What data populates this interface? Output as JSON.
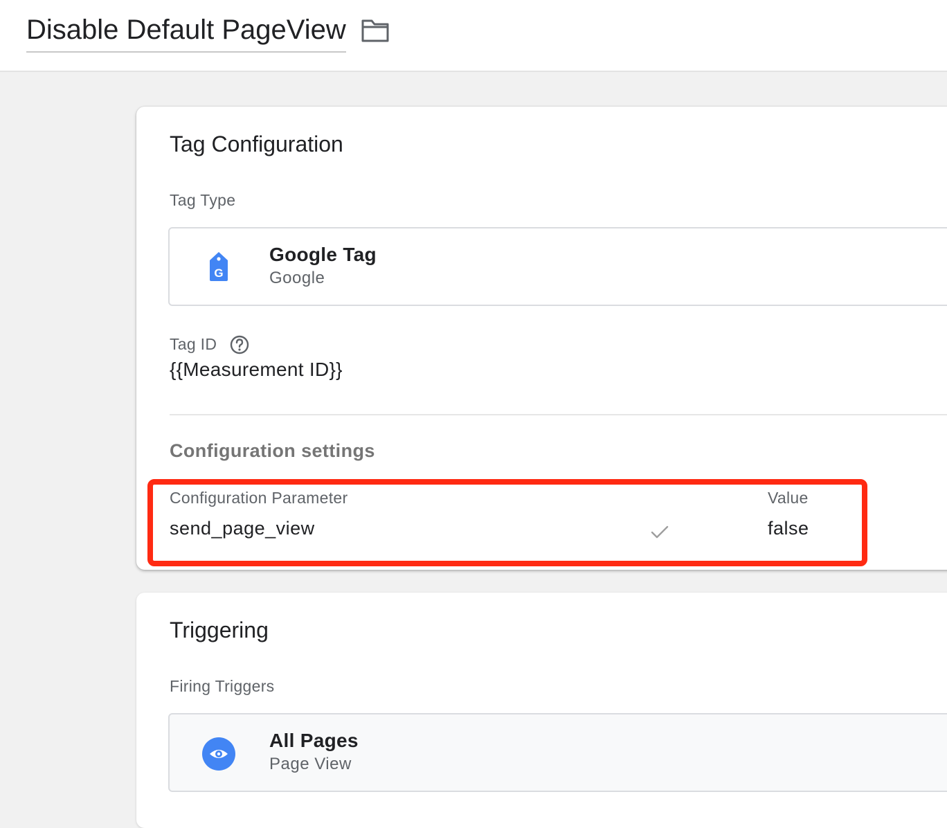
{
  "header": {
    "title": "Disable Default PageView",
    "folder_icon": "folder-icon"
  },
  "tag_configuration": {
    "title": "Tag Configuration",
    "tag_type_label": "Tag Type",
    "tag_type": {
      "icon": "google-tag-icon",
      "name": "Google Tag",
      "vendor": "Google",
      "icon_color": "#4285f4"
    },
    "tag_id_label": "Tag ID",
    "tag_id_help_icon": "help-icon",
    "tag_id_value": "{{Measurement ID}}",
    "config_settings_title": "Configuration settings",
    "table": {
      "headers": [
        "Configuration Parameter",
        "Value"
      ],
      "rows": [
        {
          "parameter": "send_page_view",
          "value": "false",
          "status_icon": "check-icon"
        }
      ]
    },
    "highlight_color": "#ff2a12"
  },
  "triggering": {
    "title": "Triggering",
    "firing_triggers_label": "Firing Triggers",
    "triggers": [
      {
        "icon": "eye-icon",
        "name": "All Pages",
        "type": "Page View",
        "icon_color": "#4285f4"
      }
    ]
  }
}
